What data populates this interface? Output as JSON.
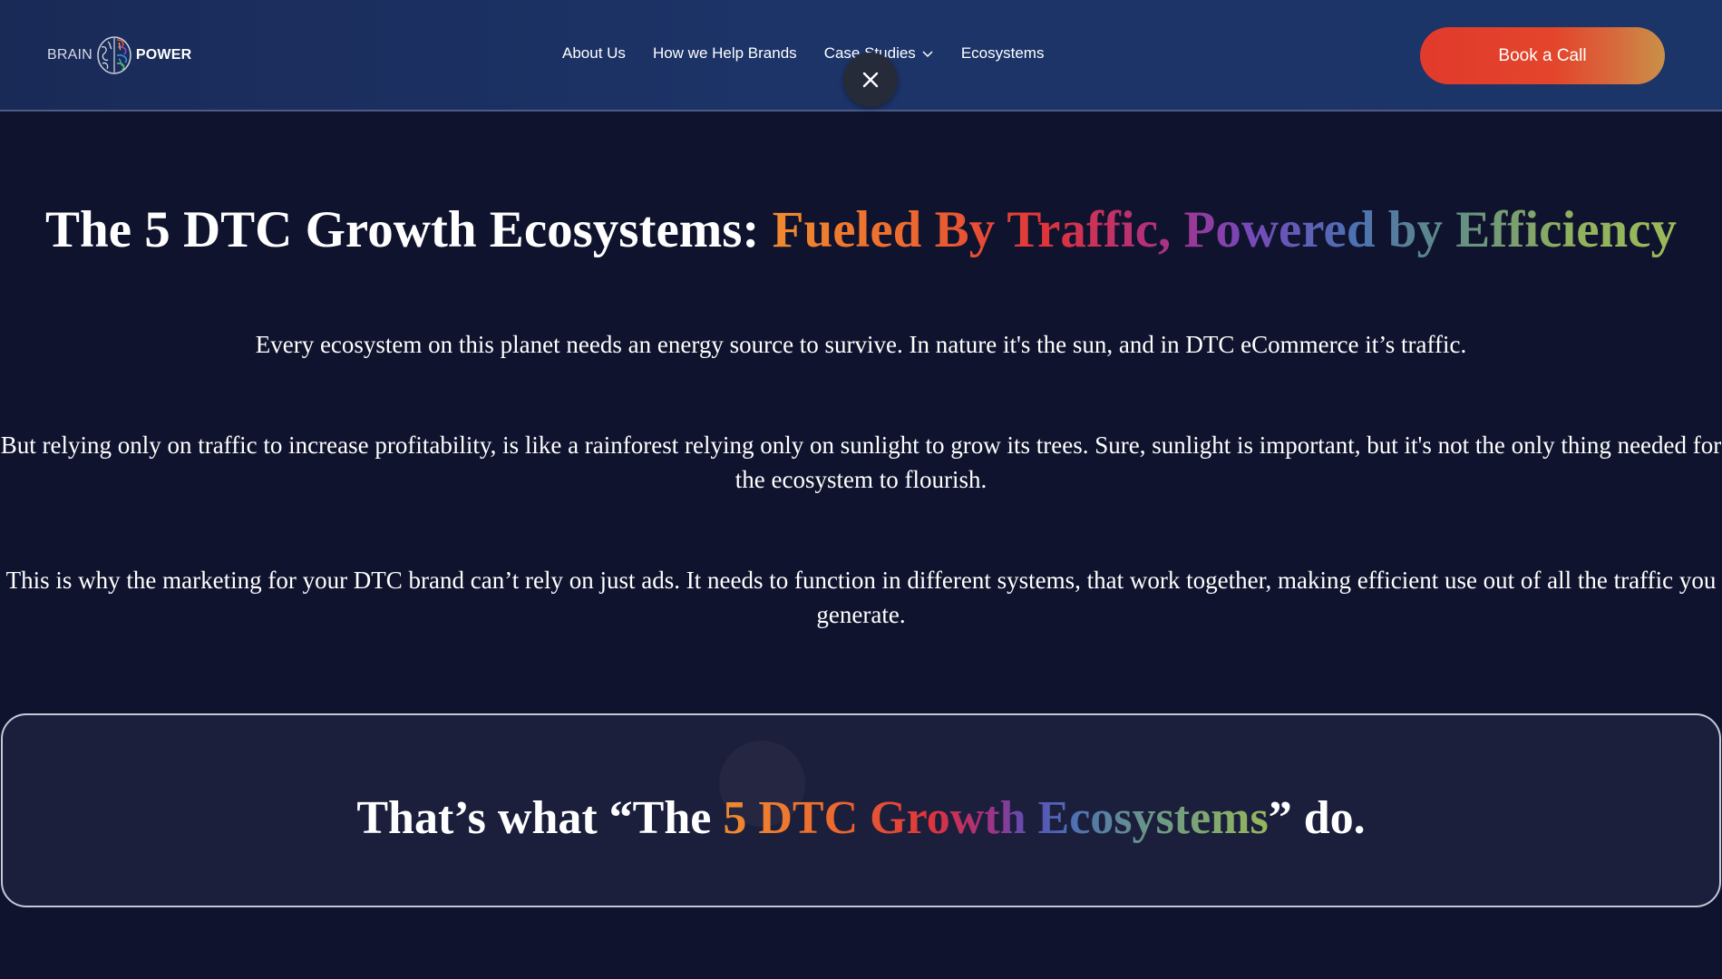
{
  "header": {
    "logo": {
      "left_word": "BRAIN",
      "right_word": "POWER",
      "icon": "brain-icon"
    },
    "nav": [
      {
        "label": "About Us"
      },
      {
        "label": "How we Help Brands"
      },
      {
        "label": "Case Studies",
        "has_dropdown": true
      },
      {
        "label": "Ecosystems"
      }
    ],
    "close_icon": "close-icon",
    "cta_label": "Book a Call"
  },
  "main": {
    "title_white": "The 5 DTC Growth Ecosystems: ",
    "title_gradient": "Fueled By Traffic, Powered by Efficiency",
    "paragraphs": [
      "Every ecosystem on this planet needs an energy source to survive. In nature it's the sun, and in DTC eCommerce it’s traffic.",
      "But relying only on traffic to increase profitability, is like a rainforest relying only on sunlight to grow its trees. Sure, sunlight is important, but it's not the only thing needed for the ecosystem to flourish.",
      "This is why the marketing for your DTC brand can’t rely on just ads. It needs to function in different systems, that work together, making efficient use out of all the traffic you generate."
    ],
    "callout": {
      "prefix": "That’s what “The ",
      "gradient": "5 DTC Growth Ecosystems",
      "suffix": "” do."
    }
  },
  "colors": {
    "background": "#0f132d",
    "header_background": "#1c3468",
    "cta_start": "#e23a2c",
    "cta_end": "#c99148",
    "callout_border": "#c5c8d6",
    "gradient_stops": [
      "#f08a30",
      "#e0343a",
      "#7a46b8",
      "#4d70b4",
      "#9bbb58"
    ]
  }
}
